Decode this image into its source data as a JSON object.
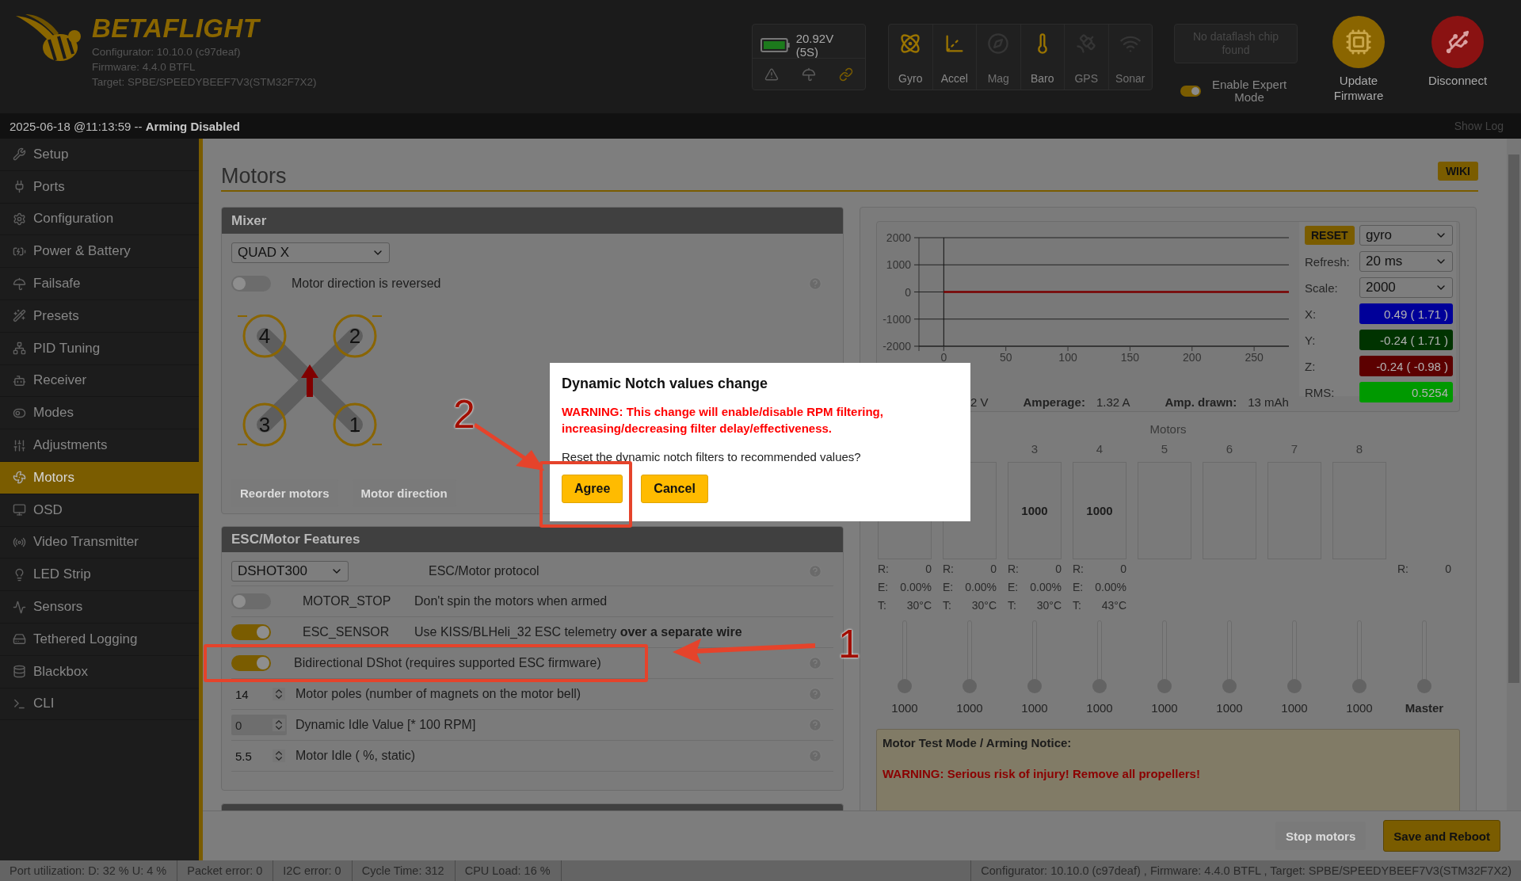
{
  "header": {
    "logo": "BETAFLIGHT",
    "version_lines": [
      "Configurator: 10.10.0 (c97deaf)",
      "Firmware: 4.4.0 BTFL",
      "Target: SPBE/SPEEDYBEEF7V3(STM32F7X2)"
    ],
    "battery": {
      "reading": "20.92V (5S)"
    },
    "sensors": [
      {
        "label": "Gyro",
        "active": true
      },
      {
        "label": "Accel",
        "active": true
      },
      {
        "label": "Mag",
        "active": false
      },
      {
        "label": "Baro",
        "active": true
      },
      {
        "label": "GPS",
        "active": false
      },
      {
        "label": "Sonar",
        "active": false
      }
    ],
    "dataflash": "No dataflash chip found",
    "expert_mode": {
      "label": "Enable Expert Mode",
      "on": true
    },
    "actions": [
      {
        "label": "Update Firmware",
        "kind": "update"
      },
      {
        "label": "Disconnect",
        "kind": "disconnect"
      }
    ]
  },
  "status_line": {
    "text": "2025-06-18 @11:13:59 -- **Arming Disabled**",
    "show_log": "Show Log"
  },
  "sidebar": {
    "items": [
      {
        "label": "Setup",
        "selected": false
      },
      {
        "label": "Ports",
        "selected": false
      },
      {
        "label": "Configuration",
        "selected": false
      },
      {
        "label": "Power & Battery",
        "selected": false
      },
      {
        "label": "Failsafe",
        "selected": false
      },
      {
        "label": "Presets",
        "selected": false
      },
      {
        "label": "PID Tuning",
        "selected": false
      },
      {
        "label": "Receiver",
        "selected": false
      },
      {
        "label": "Modes",
        "selected": false
      },
      {
        "label": "Adjustments",
        "selected": false
      },
      {
        "label": "Motors",
        "selected": true
      },
      {
        "label": "OSD",
        "selected": false
      },
      {
        "label": "Video Transmitter",
        "selected": false
      },
      {
        "label": "LED Strip",
        "selected": false
      },
      {
        "label": "Sensors",
        "selected": false
      },
      {
        "label": "Tethered Logging",
        "selected": false
      },
      {
        "label": "Blackbox",
        "selected": false
      },
      {
        "label": "CLI",
        "selected": false
      }
    ]
  },
  "page": {
    "title": "Motors",
    "wiki": "WIKI"
  },
  "mixer": {
    "title": "Mixer",
    "mixer_type": "QUAD X",
    "reversed": {
      "label": "Motor direction is reversed",
      "on": false,
      "help": true
    },
    "motor_labels": [
      "4",
      "2",
      "3",
      "1"
    ],
    "buttons": [
      {
        "label": "Reorder motors",
        "disabled": true
      },
      {
        "label": "Motor direction",
        "disabled": true
      }
    ]
  },
  "esc_features": {
    "title": "ESC/Motor Features",
    "rows": [
      {
        "kind": "select",
        "value": "DSHOT300",
        "description": "ESC/Motor protocol",
        "help": true
      },
      {
        "kind": "toggle",
        "on": false,
        "name": "MOTOR_STOP",
        "description": "Don't spin the motors when armed",
        "help": false
      },
      {
        "kind": "toggle",
        "on": true,
        "name": "ESC_SENSOR",
        "description": "Use KISS/BLHeli_32 ESC telemetry **over a separate wire**",
        "help": false
      },
      {
        "kind": "toggle",
        "on": true,
        "description": "Bidirectional DShot (requires supported ESC firmware)",
        "help": true
      },
      {
        "kind": "number",
        "value": "14",
        "disabled": false,
        "description": "Motor poles (number of magnets on the motor bell)",
        "help": true
      },
      {
        "kind": "number",
        "value": "0",
        "disabled": true,
        "description": "Dynamic Idle Value [* 100 RPM]",
        "help": true
      },
      {
        "kind": "number",
        "value": "5.5",
        "disabled": false,
        "description": "Motor Idle ( %, static)",
        "help": true
      }
    ]
  },
  "sensor_graph": {
    "reset": "RESET",
    "source": "gyro",
    "settings": [
      {
        "label": "Refresh:",
        "value": "20 ms"
      },
      {
        "label": "Scale:",
        "value": "2000"
      }
    ],
    "readouts": [
      {
        "label": "X:",
        "value": "0.49 ( 1.71 )",
        "color": "#000099"
      },
      {
        "label": "Y:",
        "value": "-0.24 ( 1.71 )",
        "color": "#003300"
      },
      {
        "label": "Z:",
        "value": "-0.24 ( -0.98 )",
        "color": "#5c0000"
      },
      {
        "label": "RMS:",
        "value": "0.5254",
        "color": "#009900"
      }
    ],
    "chart_data": {
      "type": "line",
      "x": [
        0,
        278
      ],
      "xlim": [
        -20,
        278
      ],
      "ylim": [
        -2000,
        2000
      ],
      "xticks": [
        0,
        50,
        100,
        150,
        200,
        250
      ],
      "yticks": [
        -2000,
        -1000,
        0,
        1000,
        2000
      ],
      "grid": true,
      "series": [
        {
          "color": "#7a0000",
          "values": [
            0,
            0
          ]
        }
      ]
    }
  },
  "telemetry": [
    {
      "value": "2 V"
    },
    {
      "label": "Amperage:",
      "value": "1.32 A"
    },
    {
      "label": "Amp. drawn:",
      "value": "13 mAh"
    }
  ],
  "motors": {
    "title": "Motors",
    "channels": [
      {
        "kind": "motor",
        "telemetry": [
          {
            "label": "R:",
            "value": "0"
          },
          {
            "label": "E:",
            "value": "0.00%"
          },
          {
            "label": "T:",
            "value": "30°C"
          }
        ],
        "level": 0,
        "reading": "1000"
      },
      {
        "kind": "motor",
        "telemetry": [
          {
            "label": "R:",
            "value": "0"
          },
          {
            "label": "E:",
            "value": "0.00%"
          },
          {
            "label": "T:",
            "value": "30°C"
          }
        ],
        "level": 0,
        "reading": "1000"
      },
      {
        "kind": "motor",
        "label": "3",
        "value": "1000",
        "telemetry": [
          {
            "label": "R:",
            "value": "0"
          },
          {
            "label": "E:",
            "value": "0.00%"
          },
          {
            "label": "T:",
            "value": "30°C"
          }
        ],
        "level": 0,
        "reading": "1000"
      },
      {
        "kind": "motor",
        "label": "4",
        "value": "1000",
        "telemetry": [
          {
            "label": "R:",
            "value": "0"
          },
          {
            "label": "E:",
            "value": "0.00%"
          },
          {
            "label": "T:",
            "value": "43°C"
          }
        ],
        "level": 0,
        "reading": "1000"
      },
      {
        "kind": "motor",
        "label": "5",
        "level": 0,
        "reading": "1000"
      },
      {
        "kind": "motor",
        "label": "6",
        "level": 0,
        "reading": "1000"
      },
      {
        "kind": "motor",
        "label": "7",
        "level": 0,
        "reading": "1000"
      },
      {
        "kind": "motor",
        "label": "8",
        "level": 0,
        "reading": "1000"
      },
      {
        "kind": "master",
        "telemetry": [
          {
            "label": "R:",
            "value": "0"
          }
        ],
        "level": 0,
        "reading": "Master"
      }
    ]
  },
  "notice": {
    "title": "Motor Test Mode / Arming Notice:",
    "warning": "WARNING: Serious risk of injury! Remove all propellers!"
  },
  "footer_buttons": [
    {
      "label": "Stop motors",
      "disabled": true
    },
    {
      "label": "Save and Reboot",
      "disabled": false
    }
  ],
  "status_bar": {
    "items": [
      "Port utilization: D: 32 % U: 4 %",
      "Packet error: 0",
      "I2C error: 0",
      "Cycle Time: 312",
      "CPU Load: 16 %"
    ],
    "version": "Configurator: 10.10.0 (c97deaf) , Firmware: 4.4.0 BTFL , Target: SPBE/SPEEDYBEEF7V3(STM32F7X2)"
  },
  "dialog": {
    "title": "Dynamic Notch values change",
    "warning": "WARNING: This change will enable/disable RPM filtering, increasing/decreasing filter delay/effectiveness.",
    "question": "Reset the dynamic notch filters to recommended values?",
    "buttons": [
      "Agree",
      "Cancel"
    ]
  },
  "annotations": [
    {
      "label": "1"
    },
    {
      "label": "2"
    }
  ]
}
